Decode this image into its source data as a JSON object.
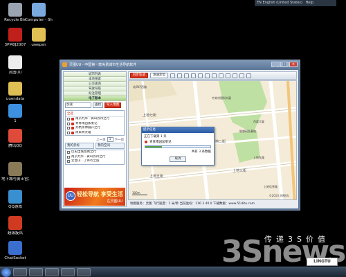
{
  "language_bar": {
    "language": "EN English (United States)",
    "help": "Help"
  },
  "desktop_icons": [
    {
      "label": "Recycle Bin",
      "color": "#9aa5b1"
    },
    {
      "label": "Computer - Shortcut",
      "color": "#7aa9e0"
    },
    {
      "label": "3PM0J2007",
      "color": "#c0201c"
    },
    {
      "label": "uwepsn",
      "color": "#e0bf54"
    },
    {
      "label": "灵图UU",
      "color": "#ececec"
    },
    {
      "label": "uuendata",
      "color": "#e0bf54"
    },
    {
      "label": "1",
      "color": "#3d8fe0"
    },
    {
      "label": "腾讯QQ",
      "color": "#e04a3a"
    },
    {
      "label": "地下城与勇士官方图标",
      "color": "#8a7a58"
    },
    {
      "label": "QQ游戏",
      "color": "#3a8fd0"
    },
    {
      "label": "超级旋风",
      "color": "#d03a20"
    },
    {
      "label": "ChatSocket",
      "color": "#3a6fd0"
    }
  ],
  "window": {
    "title": "灵图UU - 中国第一款免费城市生活导航软件",
    "minimize": "_",
    "maximize": "□",
    "close": "×"
  },
  "left_panel": {
    "menu": [
      "城市列表",
      "本地搜索",
      "公交查询",
      "驾驶导航",
      "标注管理",
      "电子账本"
    ],
    "active_menu": "电子账本",
    "search": {
      "value": "加速",
      "button": "查找",
      "red_button": "导入地图"
    },
    "list_header": "全选",
    "list_items": [
      "南京九华 · 黄山苏州之行",
      "青青南园加莱记",
      "苏杭茶博展开之行",
      "周家将大理"
    ],
    "pager": {
      "prev": "上一页",
      "page": "1",
      "next": "下一页"
    },
    "tabs": [
      "我的云标",
      "我的空间"
    ],
    "sub_items": [
      "历史出城案例之行",
      "南京九华 · 黄山苏州之行",
      "云台山 · 丁伟市之旅"
    ],
    "banner": {
      "logo": "UU",
      "headline": "轻松导航 享受生活",
      "sub": "在灵图UU"
    }
  },
  "toolbar": {
    "red_button": "同步轨迹",
    "button2": "发送定位",
    "icons": [
      "hand-icon",
      "zoom-in-icon",
      "zoom-out-icon",
      "ruler-icon",
      "mail-icon",
      "print-icon",
      "save-icon",
      "delete-icon",
      "grid-icon",
      "list-icon",
      "menu-icon",
      "settings-icon"
    ]
  },
  "map": {
    "labels": [
      "中关村银科大厦",
      "北四环西路",
      "上地七街",
      "上地五街",
      "上地三街",
      "上地二街",
      "上地东路",
      "上地信息路",
      "百度大厦",
      "联想研发基地",
      "上地五街"
    ],
    "scale": "100m",
    "copyright": "©2010 灵图UU"
  },
  "dialog": {
    "title": "提示信息",
    "line1": "正在下载第 1 条",
    "item": "青青南园加莱记",
    "progress": 0.25,
    "count": "共有 3 条数据",
    "cancel": "取消"
  },
  "statusbar": "地图服务：灵图 飞行速度：1 米/秒 当前坐标：116.3 40.0 下载数据：www.51ditu.com",
  "watermark": {
    "cn": "传递3S价值",
    "brand": "3Snews",
    "box": "LINGTU"
  }
}
